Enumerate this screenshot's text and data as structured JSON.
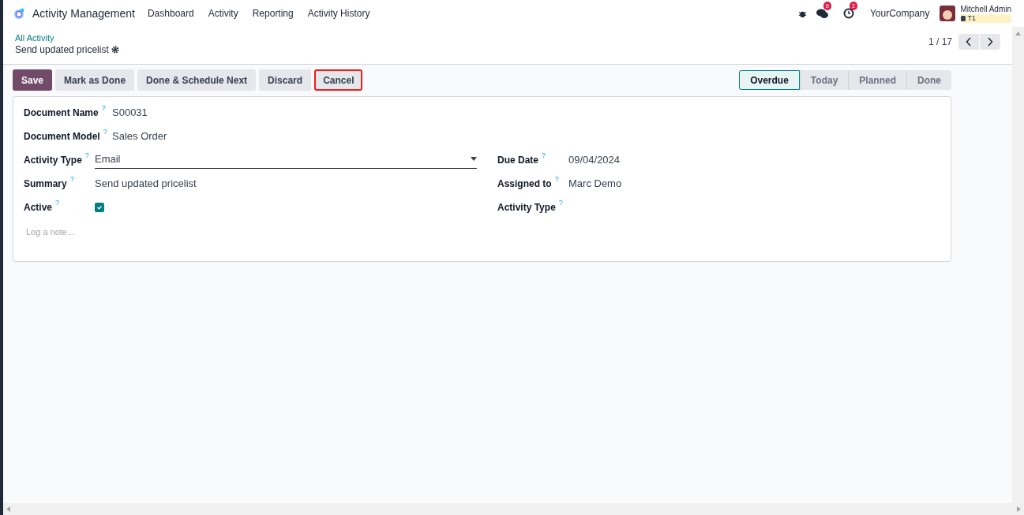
{
  "navbar": {
    "app_name": "Activity Management",
    "menu": [
      "Dashboard",
      "Activity",
      "Reporting",
      "Activity History"
    ],
    "messages_count": "6",
    "activities_count": "2",
    "company": "YourCompany",
    "user": "Mitchell Admin",
    "database": "T1"
  },
  "breadcrumb": {
    "parent": "All Activity",
    "current": "Send updated pricelist"
  },
  "pager": {
    "value": "1 / 17"
  },
  "buttons": [
    {
      "label": "Save",
      "kind": "primary",
      "highlighted": false
    },
    {
      "label": "Mark as Done",
      "kind": "secondary",
      "highlighted": false
    },
    {
      "label": "Done & Schedule Next",
      "kind": "secondary",
      "highlighted": false
    },
    {
      "label": "Discard",
      "kind": "secondary",
      "highlighted": false
    },
    {
      "label": "Cancel",
      "kind": "secondary",
      "highlighted": true
    }
  ],
  "stages": [
    {
      "label": "Overdue",
      "selected": true
    },
    {
      "label": "Today",
      "selected": false
    },
    {
      "label": "Planned",
      "selected": false
    },
    {
      "label": "Done",
      "selected": false
    }
  ],
  "top_fields": [
    {
      "label": "Document Name",
      "help": "?",
      "kind": "text",
      "value": "S00031"
    },
    {
      "label": "Document Model",
      "help": "?",
      "kind": "text",
      "value": "Sales Order"
    }
  ],
  "left_fields": [
    {
      "label": "Activity Type",
      "help": "?",
      "kind": "select",
      "value": "Email"
    },
    {
      "label": "Summary",
      "help": "?",
      "kind": "text",
      "value": "Send updated pricelist"
    },
    {
      "label": "Active",
      "help": "?",
      "kind": "checkbox",
      "checked": true
    }
  ],
  "right_fields": [
    {
      "label": "Due Date",
      "help": "?",
      "kind": "text",
      "value": "09/04/2024"
    },
    {
      "label": "Assigned to",
      "help": "?",
      "kind": "text",
      "value": "Marc Demo"
    },
    {
      "label": "Activity Type",
      "help": "?",
      "kind": "empty"
    }
  ],
  "note": {
    "placeholder": "Log a note..."
  }
}
